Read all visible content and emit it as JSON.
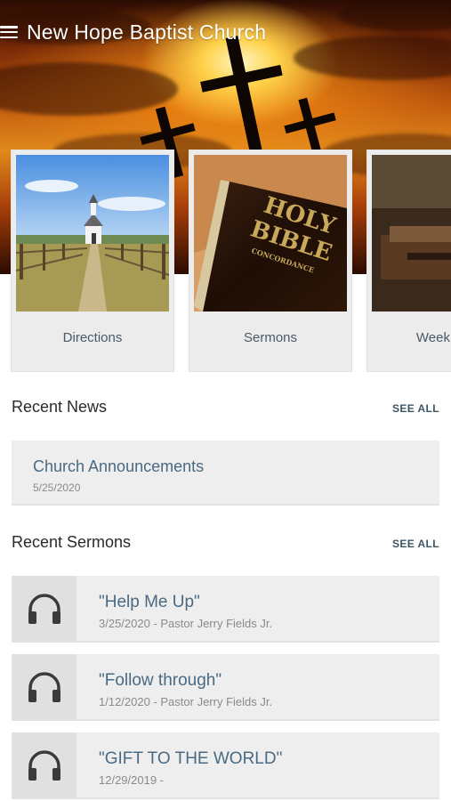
{
  "header": {
    "title": "New Hope Baptist Church",
    "menu_icon": "hamburger-menu-icon"
  },
  "tiles": [
    {
      "label": "Directions",
      "image": "country-chapel-photo"
    },
    {
      "label": "Sermons",
      "image": "holy-bible-photo"
    },
    {
      "label": "Weekly De",
      "image": "church-pews-photo"
    }
  ],
  "news": {
    "heading": "Recent News",
    "see_all": "SEE ALL",
    "items": [
      {
        "title": "Church Announcements",
        "date": "5/25/2020"
      }
    ]
  },
  "sermons": {
    "heading": "Recent Sermons",
    "see_all": "SEE ALL",
    "icon": "headphones-icon",
    "items": [
      {
        "title": "\"Help Me Up\"",
        "meta": "3/25/2020 - Pastor Jerry Fields Jr."
      },
      {
        "title": "\"Follow through\"",
        "meta": "1/12/2020 - Pastor Jerry Fields Jr."
      },
      {
        "title": "\"GIFT TO THE WORLD\"",
        "meta": "12/29/2019 -"
      }
    ]
  },
  "colors": {
    "accent": "#4a6a82",
    "card_background": "#eeeeee",
    "see_all": "#3d5567"
  }
}
